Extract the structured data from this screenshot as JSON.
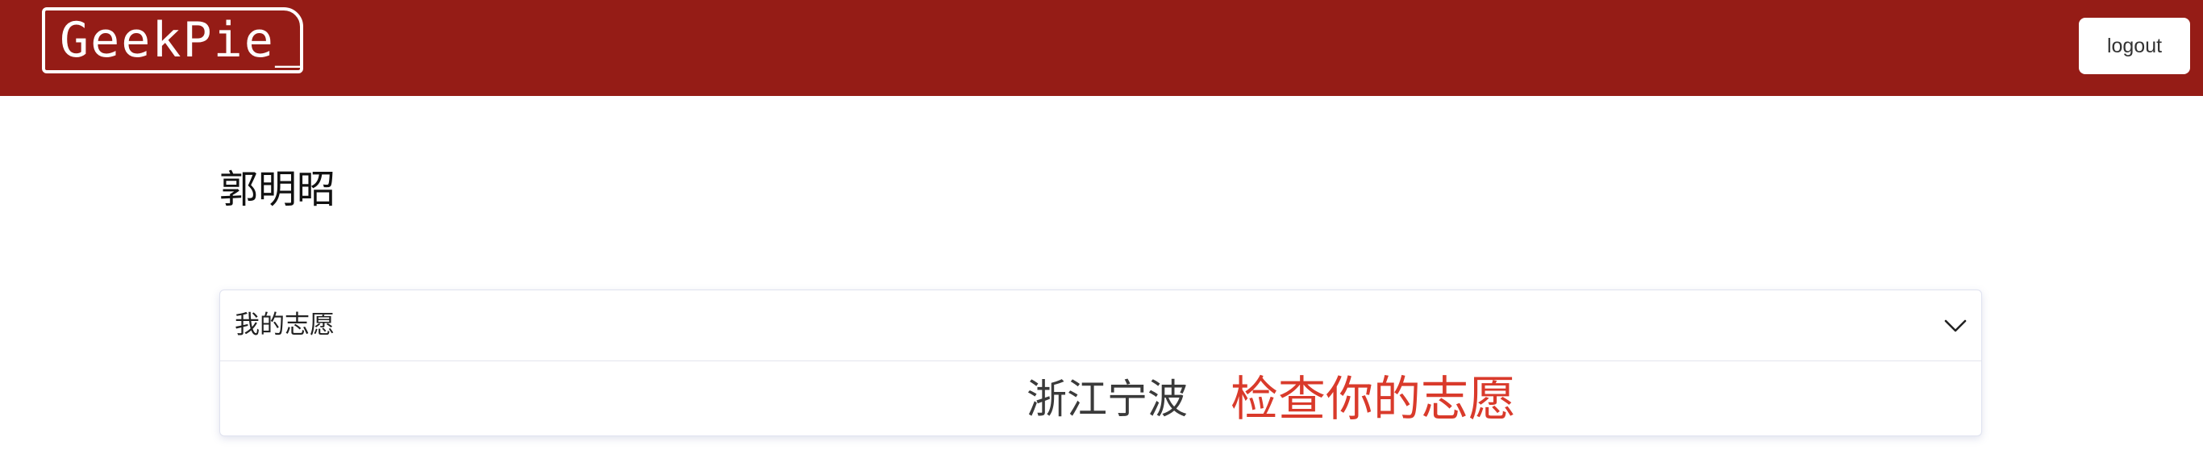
{
  "header": {
    "logo_text": "GeekPie_",
    "logout_label": "logout",
    "brand_color": "#951c16"
  },
  "main": {
    "user_name": "郭明昭",
    "panel": {
      "title": "我的志愿",
      "expanded": true,
      "toggle_icon": "chevron-down-icon",
      "region": "浙江宁波",
      "check_link": "检查你的志愿",
      "link_color": "#d93a2b"
    }
  }
}
